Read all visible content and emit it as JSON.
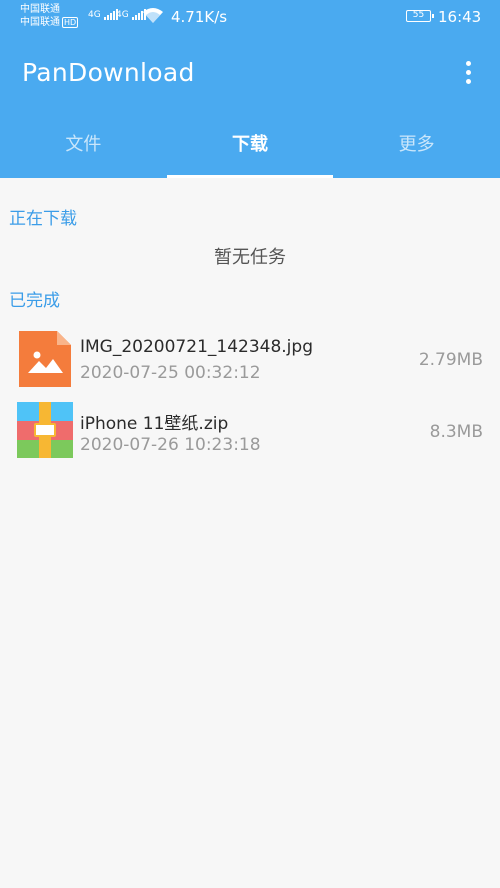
{
  "status_bar": {
    "carrier_1": "中国联通",
    "carrier_2": "中国联通",
    "hd_badge": "HD",
    "net_1": "4G",
    "net_2": "4G",
    "speed": "4.71K/s",
    "battery": "55",
    "time": "16:43"
  },
  "appbar": {
    "title": "PanDownload",
    "menu_icon": "more-vert-icon"
  },
  "tabs": [
    {
      "label": "文件"
    },
    {
      "label": "下载",
      "active": true
    },
    {
      "label": "更多"
    }
  ],
  "downloading": {
    "heading": "正在下载",
    "empty_text": "暂无任务"
  },
  "completed": {
    "heading": "已完成",
    "items": [
      {
        "name": "IMG_20200721_142348.jpg",
        "date": "2020-07-25 00:32:12",
        "size": "2.79MB",
        "icon": "image-file-icon"
      },
      {
        "name": "iPhone 11壁纸.zip",
        "date": "2020-07-26 10:23:18",
        "size": "8.3MB",
        "icon": "zip-archive-icon"
      }
    ]
  },
  "colors": {
    "primary": "#4aaaf0",
    "accent_text": "#3b9de8",
    "image_icon": "#f47c3c"
  }
}
